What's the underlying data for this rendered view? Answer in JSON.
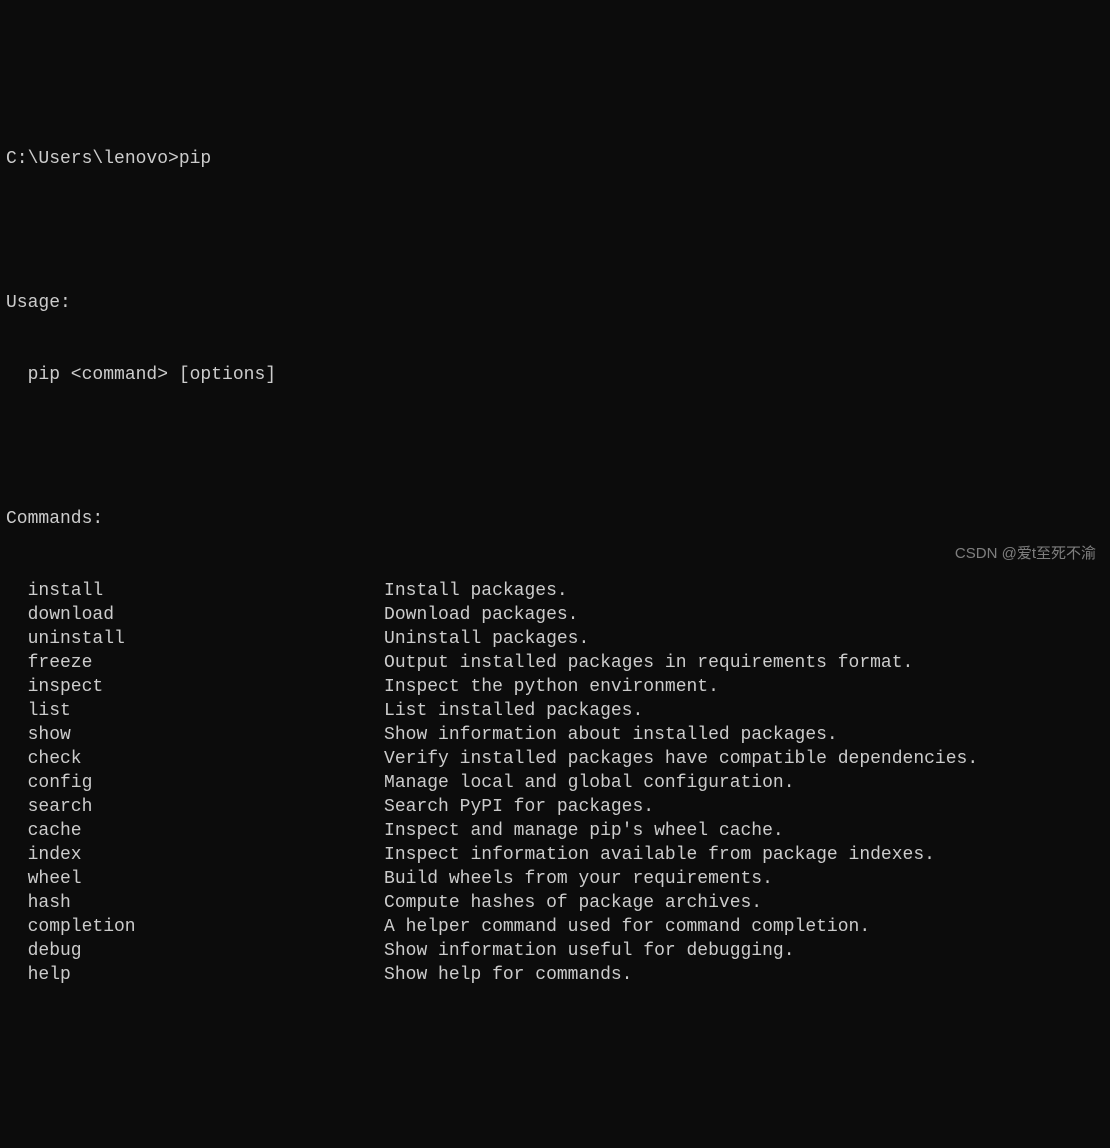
{
  "prompt": {
    "path": "C:\\Users\\lenovo>",
    "command": "pip"
  },
  "usage_header": "Usage:",
  "usage_line": "  pip <command> [options]",
  "commands_header": "Commands:",
  "commands": [
    {
      "name": "install",
      "desc": "Install packages."
    },
    {
      "name": "download",
      "desc": "Download packages."
    },
    {
      "name": "uninstall",
      "desc": "Uninstall packages."
    },
    {
      "name": "freeze",
      "desc": "Output installed packages in requirements format."
    },
    {
      "name": "inspect",
      "desc": "Inspect the python environment."
    },
    {
      "name": "list",
      "desc": "List installed packages."
    },
    {
      "name": "show",
      "desc": "Show information about installed packages."
    },
    {
      "name": "check",
      "desc": "Verify installed packages have compatible dependencies."
    },
    {
      "name": "config",
      "desc": "Manage local and global configuration."
    },
    {
      "name": "search",
      "desc": "Search PyPI for packages."
    },
    {
      "name": "cache",
      "desc": "Inspect and manage pip's wheel cache."
    },
    {
      "name": "index",
      "desc": "Inspect information available from package indexes."
    },
    {
      "name": "wheel",
      "desc": "Build wheels from your requirements."
    },
    {
      "name": "hash",
      "desc": "Compute hashes of package archives."
    },
    {
      "name": "completion",
      "desc": "A helper command used for command completion."
    },
    {
      "name": "debug",
      "desc": "Show information useful for debugging."
    },
    {
      "name": "help",
      "desc": "Show help for commands."
    }
  ],
  "watermark": "CSDN @爱t至死不渝"
}
